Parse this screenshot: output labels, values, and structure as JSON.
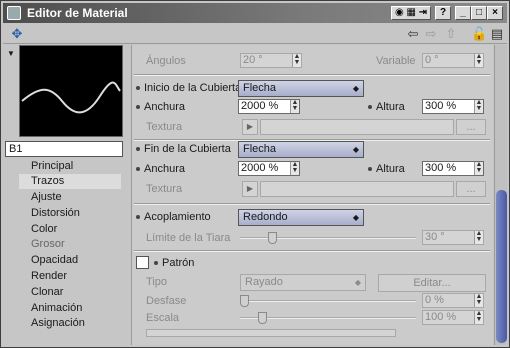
{
  "window": {
    "title": "Editor de Material",
    "controls": [
      "?",
      "_",
      "□",
      "×"
    ]
  },
  "left": {
    "material_name": "B1",
    "items": [
      {
        "label": "Principal"
      },
      {
        "label": "Trazos",
        "active": true
      },
      {
        "label": "Ajuste"
      },
      {
        "label": "Distorsión"
      },
      {
        "label": "Color"
      },
      {
        "label": "Grosor",
        "dim": true
      },
      {
        "label": "Opacidad"
      },
      {
        "label": "Render"
      },
      {
        "label": "Clonar"
      },
      {
        "label": "Animación"
      },
      {
        "label": "Asignación"
      }
    ]
  },
  "main": {
    "top": {
      "angulos_label": "Ángulos",
      "angulos_value": "20 °",
      "variable_label": "Variable",
      "variable_value": "0 °"
    },
    "start_cap": {
      "label": "Inicio de la Cubierta",
      "value": "Flecha",
      "width_label": "Anchura",
      "width_value": "2000 %",
      "height_label": "Altura",
      "height_value": "300 %",
      "texture_label": "Textura",
      "texture_button": "..."
    },
    "end_cap": {
      "label": "Fin de la Cubierta",
      "value": "Flecha",
      "width_label": "Anchura",
      "width_value": "2000 %",
      "height_label": "Altura",
      "height_value": "300 %",
      "texture_label": "Textura",
      "texture_button": "..."
    },
    "joins": {
      "label": "Acoplamiento",
      "value": "Redondo",
      "tiara_label": "Límite de la Tiara",
      "tiara_value": "30 °"
    },
    "pattern": {
      "label": "Patrón",
      "tipo_label": "Tipo",
      "tipo_value": "Rayado",
      "edit_button": "Editar...",
      "desfase_label": "Desfase",
      "desfase_value": "0 %",
      "escala_label": "Escala",
      "escala_value": "100 %"
    }
  }
}
